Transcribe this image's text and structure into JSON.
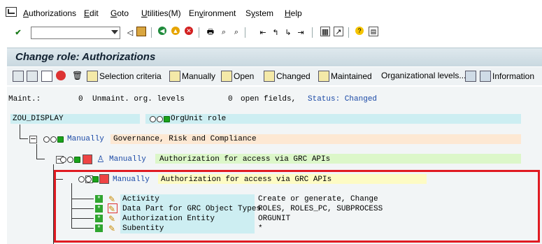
{
  "menu": [
    "Authorizations",
    "Edit",
    "Goto",
    "Utilities(M)",
    "Environment",
    "System",
    "Help"
  ],
  "menu_underline": [
    "A",
    "E",
    "G",
    "U",
    "v",
    "y",
    "H"
  ],
  "window": {
    "title": "Change role: Authorizations"
  },
  "app_toolbar": {
    "selection_criteria": "Selection criteria",
    "manually": "Manually",
    "open": "Open",
    "changed": "Changed",
    "maintained": "Maintained",
    "org_levels": "Organizational levels...",
    "information": "Information"
  },
  "status": {
    "maint_label": "Maint.:",
    "maint_value": "0",
    "unmaint_label": "Unmaint. org. levels",
    "open_value": "0",
    "open_label": "open fields,",
    "status_label": "Status: Changed"
  },
  "tree": {
    "root_name": "ZOU_DISPLAY",
    "root_desc": "OrgUnit role",
    "l1_type": "Manually",
    "l1_desc": "Governance, Risk and Compliance",
    "l2_type": "Manually",
    "l2_desc": "Authorization for access via GRC APIs",
    "l3_type": "Manually",
    "l3_desc": "Authorization for access via GRC APIs",
    "fields": [
      {
        "name": "Activity",
        "value": "Create or generate, Change"
      },
      {
        "name": "Data Part for GRC Object Types",
        "value": "ROLES, ROLES_PC, SUBPROCESS"
      },
      {
        "name": "Authorization Entity",
        "value": "ORGUNIT"
      },
      {
        "name": "Subentity",
        "value": "*"
      }
    ]
  },
  "colors": {
    "cyan": "#cdeef2",
    "orange": "#fde8d3",
    "green": "#dcf7c9",
    "yellow": "#fdfbc4",
    "highlight_red": "#e01b22"
  }
}
